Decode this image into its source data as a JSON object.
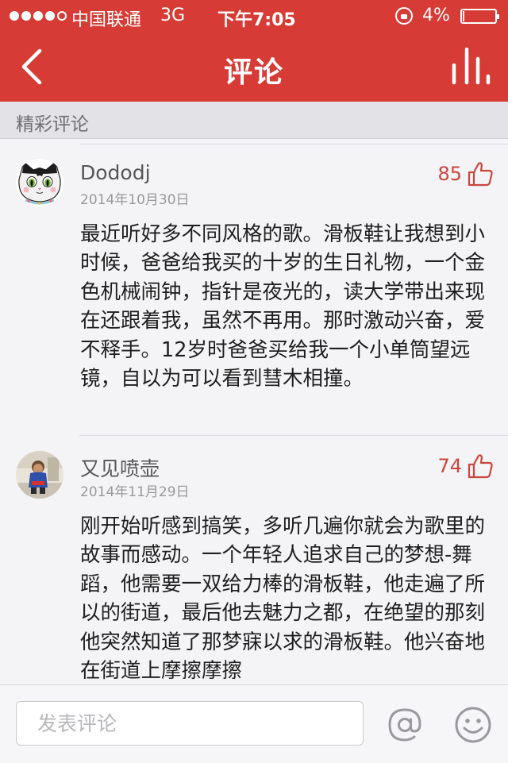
{
  "status_bar": {
    "carrier": "中国联通",
    "network": "3G",
    "time": "下午7:05",
    "battery_percent": "4%",
    "battery_level": 0.04,
    "signal_strength": 4,
    "signal_max": 5
  },
  "nav": {
    "title": "评论",
    "back_icon": "chevron-left-icon",
    "menu_icon": "bars-icon"
  },
  "section": {
    "title": "精彩评论"
  },
  "comments": [
    {
      "username": "Dododj",
      "date": "2014年10月30日",
      "likes": "85",
      "avatar": "cat-avatar",
      "text": "最近听好多不同风格的歌。滑板鞋让我想到小时候，爸爸给我买的十岁的生日礼物，一个金色机械闹钟，指针是夜光的，读大学带出来现在还跟着我，虽然不再用。那时激动兴奋，爱不释手。12岁时爸爸买给我一个小单筒望远镜，自以为可以看到彗木相撞。"
    },
    {
      "username": "又见喷壶",
      "date": "2014年11月29日",
      "likes": "74",
      "avatar": "child-photo-avatar",
      "text": "刚开始听感到搞笑，多听几遍你就会为歌里的故事而感动。一个年轻人追求自己的梦想-舞蹈，他需要一双给力棒的滑板鞋，他走遍了所以的街道，最后他去魅力之都，在绝望的那刻他突然知道了那梦寐以求的滑板鞋。他兴奋地在街道上摩擦摩擦"
    }
  ],
  "composer": {
    "placeholder": "发表评论",
    "value": "",
    "at_icon": "at-sign-icon",
    "emoji_icon": "smiley-icon"
  },
  "colors": {
    "accent": "#d63b35",
    "like": "#c9453d"
  }
}
